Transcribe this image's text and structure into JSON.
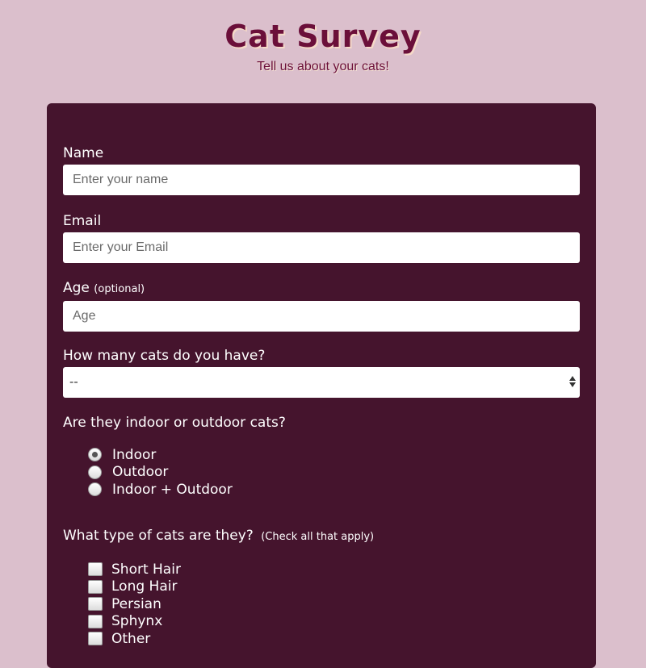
{
  "header": {
    "title": "Cat Survey",
    "subtitle": "Tell us about your cats!"
  },
  "form": {
    "name": {
      "label": "Name",
      "placeholder": "Enter your name"
    },
    "email": {
      "label": "Email",
      "placeholder": "Enter your Email"
    },
    "age": {
      "label": "Age",
      "note": "(optional)",
      "placeholder": "Age"
    },
    "cat_count": {
      "label": "How many cats do you have?",
      "selected": "--"
    },
    "location": {
      "label": "Are they indoor or outdoor cats?",
      "options": [
        "Indoor",
        "Outdoor",
        "Indoor + Outdoor"
      ],
      "selected": "Indoor"
    },
    "types": {
      "label": "What type of cats are they?",
      "note": "(Check all that apply)",
      "options": [
        "Short Hair",
        "Long Hair",
        "Persian",
        "Sphynx",
        "Other"
      ]
    }
  },
  "colors": {
    "page_background": "#dbbfcc",
    "form_background": "#45142d",
    "title_color": "#6b0f3a"
  }
}
